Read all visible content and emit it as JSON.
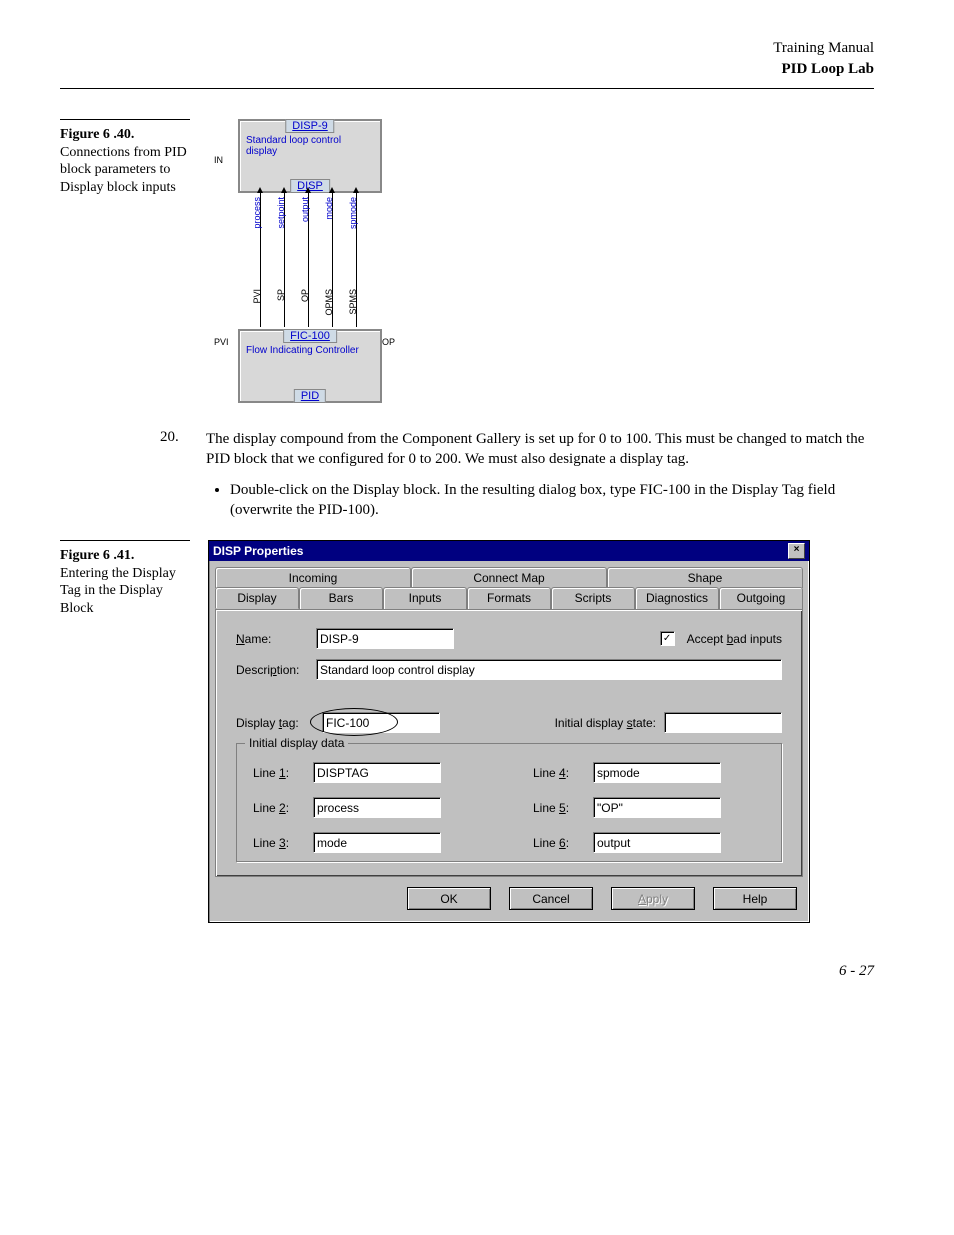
{
  "header": {
    "line1": "Training Manual",
    "line2": "PID Loop Lab"
  },
  "figure40": {
    "title": "Figure 6 .40.",
    "caption": "Connections from PID block parameters to Display block inputs",
    "diagram": {
      "top_title": "DISP-9",
      "top_desc": "Standard loop control display",
      "top_tag": "DISP",
      "bot_title": "FIC-100",
      "bot_desc": "Flow Indicating Controller",
      "bot_tag": "PID",
      "in_label": "IN",
      "pvi_label": "PVI",
      "op_label": "OP",
      "top_ports": [
        "process",
        "setpoint",
        "output",
        "mode",
        "spmode"
      ],
      "bot_ports": [
        "PVI",
        "SP",
        "OP",
        "OPMS",
        "SPMS"
      ]
    }
  },
  "step20": {
    "num": "20.",
    "text": "The display compound from the Component Gallery is set up for 0 to 100.  This must be changed to match the PID block that we configured for 0 to 200.  We must also designate a display tag.",
    "bullet": "Double-click on the Display block.  In the resulting dialog box, type  FIC-100  in the Display Tag field (overwrite the PID-100)."
  },
  "figure41": {
    "title": "Figure 6 .41.",
    "caption": "Entering the Display Tag in the Display Block"
  },
  "dialog": {
    "title": "DISP Properties",
    "tabs_back": [
      "Incoming",
      "Connect Map",
      "Shape"
    ],
    "tabs_front": [
      "Display",
      "Bars",
      "Inputs",
      "Formats",
      "Scripts",
      "Diagnostics",
      "Outgoing"
    ],
    "active_tab": "Display",
    "labels": {
      "name": "Name:",
      "description": "Description:",
      "display_tag": "Display tag:",
      "initial_state": "Initial display state:",
      "accept_bad": "Accept bad inputs",
      "fieldset": "Initial display data",
      "line1": "Line 1:",
      "line2": "Line 2:",
      "line3": "Line 3:",
      "line4": "Line 4:",
      "line5": "Line 5:",
      "line6": "Line 6:"
    },
    "values": {
      "name": "DISP-9",
      "description": "Standard loop control display",
      "display_tag": "FIC-100",
      "initial_state": "",
      "accept_bad_checked": true,
      "line1": "DISPTAG",
      "line2": "process",
      "line3": "mode",
      "line4": "spmode",
      "line5": "\"OP\"",
      "line6": "output"
    },
    "buttons": {
      "ok": "OK",
      "cancel": "Cancel",
      "apply": "Apply",
      "help": "Help"
    }
  },
  "page_num": "6 - 27"
}
